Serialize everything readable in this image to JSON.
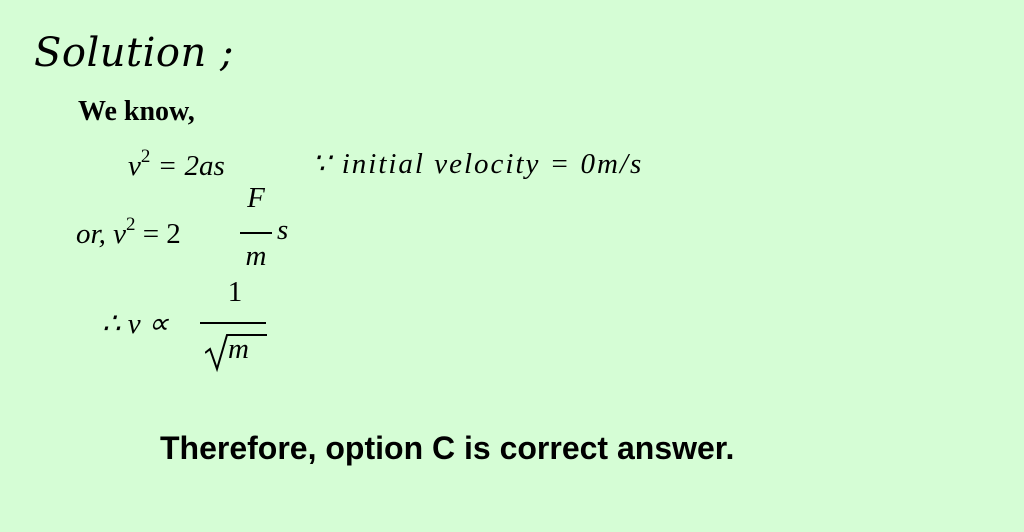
{
  "solution": {
    "heading": "Solution ;",
    "intro": "We know,",
    "eq1_lhs": "v",
    "eq1_power": "2",
    "eq1_rhs": " = 2as",
    "eq1_condition": "∵ initial velocity = 0m/s",
    "eq2_prefix": "or,  v",
    "eq2_power": "2",
    "eq2_mid": " = 2",
    "eq2_numerator": "F",
    "eq2_denominator": "m",
    "eq2_suffix": "s",
    "eq3_lhs": "∴ v ∝",
    "eq3_numerator": "1",
    "eq3_radicand": "m",
    "conclusion": "Therefore, option C is correct answer."
  }
}
